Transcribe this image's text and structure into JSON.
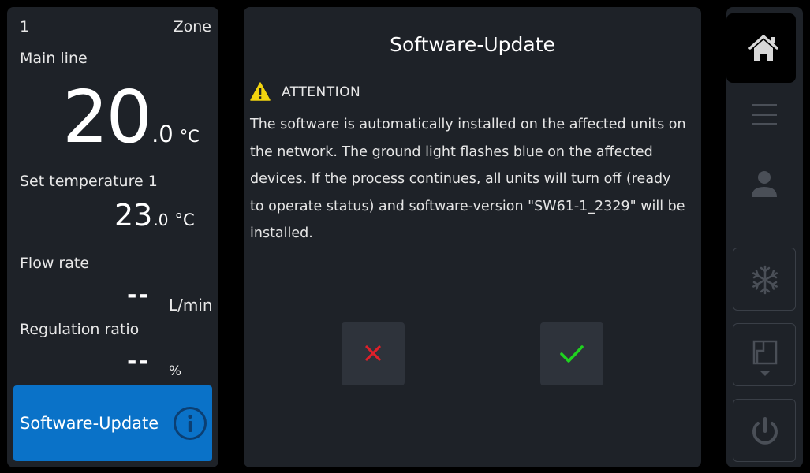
{
  "zone_panel": {
    "zone_number": "1",
    "zone_label": "Zone",
    "main_line_label": "Main line",
    "main_temp_int": "20",
    "main_temp_dec": ".0",
    "main_temp_unit": "°C",
    "set_temp_label": "Set temperature 1",
    "set_temp_int": "23",
    "set_temp_dec": ".0",
    "set_temp_unit": "°C",
    "flow_rate_label": "Flow rate",
    "flow_rate_value": "--",
    "flow_rate_unit": "L/min",
    "regulation_label": "Regulation ratio",
    "regulation_value": "--",
    "regulation_unit": "%",
    "software_update_button": "Software-Update"
  },
  "dialog": {
    "title": "Software-Update",
    "attention": "ATTENTION",
    "message": "The software is automatically installed on the affected units on the network. The ground light flashes blue on the affected devices. If the process continues, all units will turn off (ready to operate status) and software-version \"SW61-1_2329\" will be installed.",
    "cancel_icon": "close-icon",
    "confirm_icon": "check-icon"
  },
  "nav": {
    "items": [
      "home-icon",
      "menu-icon",
      "user-icon",
      "snowflake-icon",
      "door-icon",
      "power-icon"
    ],
    "active": "home-icon"
  },
  "colors": {
    "accent_blue": "#0a72c8",
    "warning_yellow": "#f2d40f",
    "cancel_red": "#e0202a",
    "confirm_green": "#1fd21f",
    "panel_bg": "#1e2228"
  }
}
